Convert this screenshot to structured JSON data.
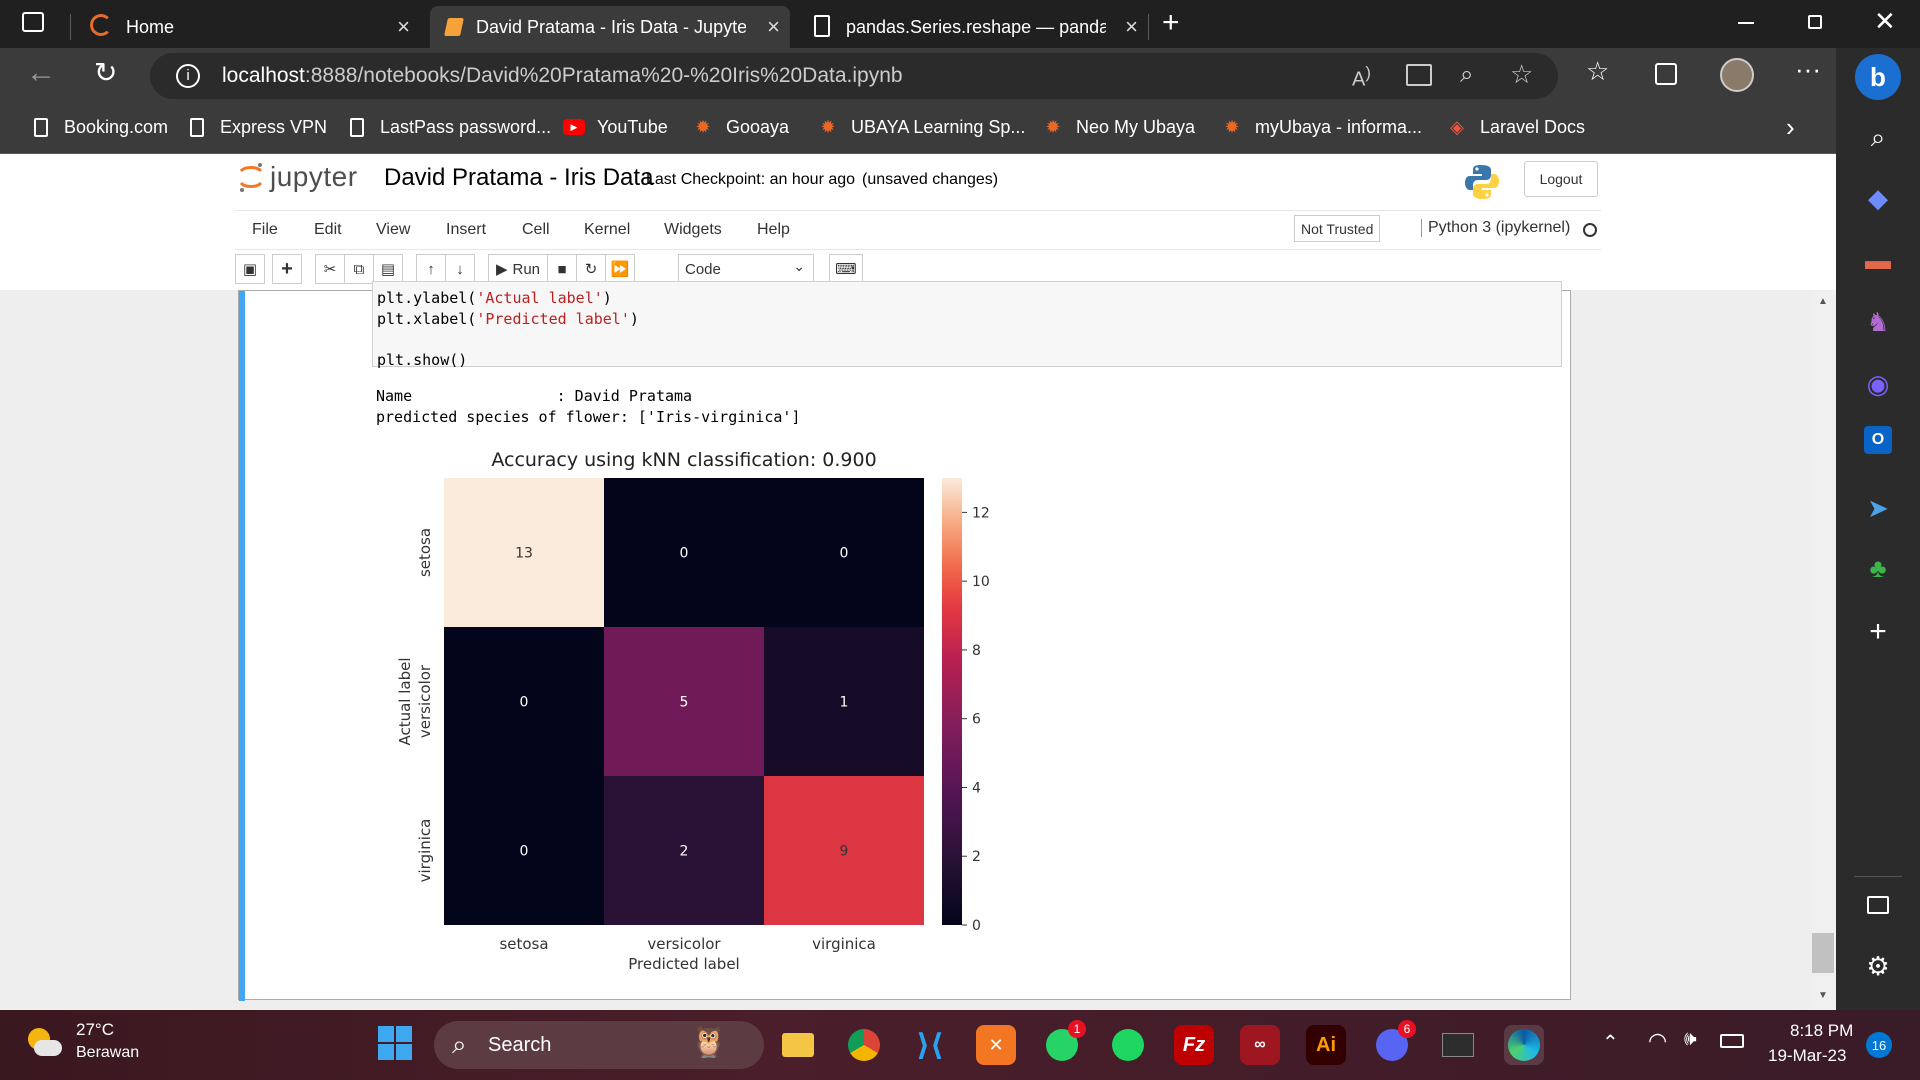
{
  "browser": {
    "tabs": [
      {
        "label": "Home"
      },
      {
        "label": "David Pratama - Iris Data - Jupyter"
      },
      {
        "label": "pandas.Series.reshape — pandas"
      }
    ],
    "url_host": "localhost",
    "url_rest": ":8888/notebooks/David%20Pratama%20-%20Iris%20Data.ipynb",
    "bookmarks": [
      {
        "label": "Booking.com",
        "icon": "page-icon"
      },
      {
        "label": "Express VPN",
        "icon": "page-icon"
      },
      {
        "label": "LastPass password...",
        "icon": "page-icon"
      },
      {
        "label": "YouTube",
        "icon": "youtube-icon"
      },
      {
        "label": "Gooaya",
        "icon": "ubaya-icon"
      },
      {
        "label": "UBAYA Learning Sp...",
        "icon": "ubaya-icon"
      },
      {
        "label": "Neo My Ubaya",
        "icon": "ubaya-icon"
      },
      {
        "label": "myUbaya - informa...",
        "icon": "ubaya-icon"
      },
      {
        "label": "Laravel Docs",
        "icon": "laravel-icon"
      }
    ]
  },
  "jupyter": {
    "logo_text": "jupyter",
    "notebook_title": "David Pratama - Iris Data",
    "checkpoint": "Last Checkpoint: an hour ago",
    "unsaved": "(unsaved changes)",
    "logout": "Logout",
    "menu": [
      "File",
      "Edit",
      "View",
      "Insert",
      "Cell",
      "Kernel",
      "Widgets",
      "Help"
    ],
    "trust": "Not Trusted",
    "kernel": "Python 3 (ipykernel)",
    "run_label": "Run",
    "cell_type": "Code"
  },
  "cell": {
    "code_lines": [
      {
        "pre": "plt.ylabel(",
        "str": "'Actual label'",
        "post": ")"
      },
      {
        "pre": "plt.xlabel(",
        "str": "'Predicted label'",
        "post": ")"
      },
      {
        "pre": "",
        "str": "",
        "post": ""
      },
      {
        "pre": "plt.show()",
        "str": "",
        "post": ""
      }
    ],
    "output_lines": [
      "Name                : David Pratama",
      "predicted species of flower: ['Iris-virginica']"
    ]
  },
  "chart_data": {
    "type": "heatmap",
    "title": "Accuracy using kNN classification: 0.900",
    "xlabel": "Predicted label",
    "ylabel": "Actual label",
    "x_categories": [
      "setosa",
      "versicolor",
      "virginica"
    ],
    "y_categories": [
      "setosa",
      "versicolor",
      "virginica"
    ],
    "values": [
      [
        13,
        0,
        0
      ],
      [
        0,
        5,
        1
      ],
      [
        0,
        2,
        9
      ]
    ],
    "colorbar": {
      "min": 0,
      "max": 13,
      "ticks": [
        0,
        2,
        4,
        6,
        8,
        10,
        12
      ]
    },
    "colormap": "rocket"
  },
  "taskbar": {
    "weather_temp": "27°C",
    "weather_desc": "Berawan",
    "search_placeholder": "Search",
    "whatsapp_badge": "1",
    "discord_badge": "6",
    "time": "8:18 PM",
    "date": "19-Mar-23",
    "notifications": "16"
  }
}
